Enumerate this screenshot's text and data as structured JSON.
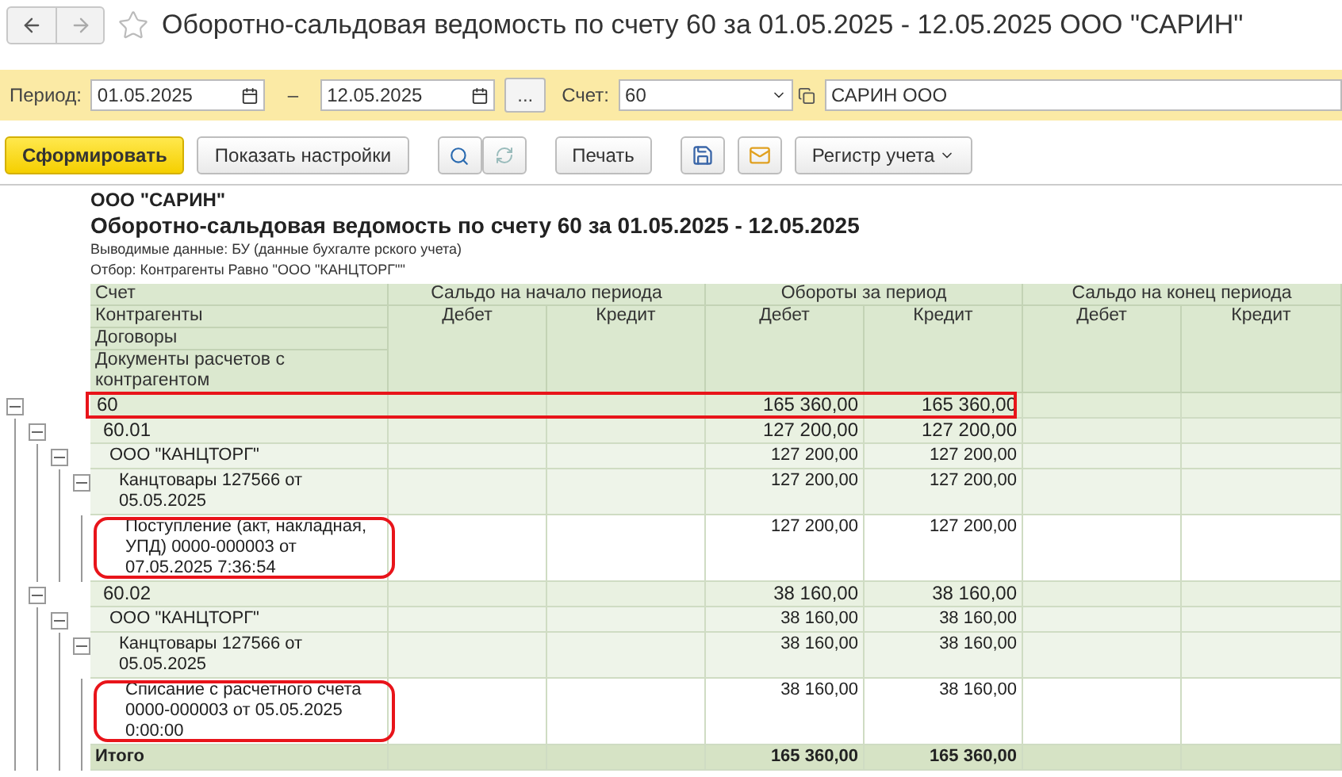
{
  "window": {
    "title": "Оборотно-сальдовая ведомость по счету 60 за 01.05.2025 - 12.05.2025 ООО \"САРИН\""
  },
  "filters": {
    "period_label": "Период:",
    "date_from": "01.05.2025",
    "dash": "–",
    "date_to": "12.05.2025",
    "more_button": "...",
    "account_label": "Счет:",
    "account": "60",
    "organization": "САРИН ООО"
  },
  "toolbar": {
    "generate": "Сформировать",
    "show_settings": "Показать настройки",
    "print": "Печать",
    "register": "Регистр учета"
  },
  "report": {
    "organization": "ООО \"САРИН\"",
    "title": "Оборотно-сальдовая ведомость по счету 60 за 01.05.2025 - 12.05.2025",
    "output": "Выводимые данные: БУ (данные бухгалте рского учета)",
    "filter": "Отбор: Контрагенты Равно \"ООО \"КАНЦТОРГ\"\""
  },
  "table": {
    "row_headers": [
      "Счет",
      "Контрагенты",
      "Договоры",
      "Документы расчетов с контрагентом"
    ],
    "groups": [
      {
        "label": "Сальдо на начало периода",
        "columns": [
          "Дебет",
          "Кредит"
        ]
      },
      {
        "label": "Обороты за период",
        "columns": [
          "Дебет",
          "Кредит"
        ]
      },
      {
        "label": "Сальдо на конец периода",
        "columns": [
          "Дебет",
          "Кредит"
        ]
      }
    ],
    "rows": [
      {
        "kind": "account",
        "label": "60",
        "turnover_debit": "165 360,00",
        "turnover_credit": "165 360,00",
        "expanded": true,
        "highlighted": true,
        "children": [
          {
            "kind": "subaccount",
            "label": "60.01",
            "turnover_debit": "127 200,00",
            "turnover_credit": "127 200,00",
            "expanded": true,
            "children": [
              {
                "kind": "counterparty",
                "label": "ООО \"КАНЦТОРГ\"",
                "turnover_debit": "127 200,00",
                "turnover_credit": "127 200,00",
                "expanded": true,
                "children": [
                  {
                    "kind": "contract",
                    "label": "Канцтовары 127566 от 05.05.2025",
                    "turnover_debit": "127 200,00",
                    "turnover_credit": "127 200,00",
                    "expanded": true,
                    "children": [
                      {
                        "kind": "document",
                        "label": "Поступление (акт, накладная, УПД) 0000-000003 от 07.05.2025 7:36:54",
                        "turnover_debit": "127 200,00",
                        "turnover_credit": "127 200,00",
                        "highlighted": true
                      }
                    ]
                  }
                ]
              }
            ]
          },
          {
            "kind": "subaccount",
            "label": "60.02",
            "turnover_debit": "38 160,00",
            "turnover_credit": "38 160,00",
            "expanded": true,
            "children": [
              {
                "kind": "counterparty",
                "label": "ООО \"КАНЦТОРГ\"",
                "turnover_debit": "38 160,00",
                "turnover_credit": "38 160,00",
                "expanded": true,
                "children": [
                  {
                    "kind": "contract",
                    "label": "Канцтовары 127566 от 05.05.2025",
                    "turnover_debit": "38 160,00",
                    "turnover_credit": "38 160,00",
                    "expanded": true,
                    "children": [
                      {
                        "kind": "document",
                        "label": "Списание с расчетного счета 0000-000003 от 05.05.2025 0:00:00",
                        "turnover_debit": "38 160,00",
                        "turnover_credit": "38 160,00",
                        "highlighted": true
                      }
                    ]
                  }
                ]
              }
            ]
          }
        ]
      }
    ],
    "total": {
      "label": "Итого",
      "turnover_debit": "165 360,00",
      "turnover_credit": "165 360,00"
    }
  }
}
